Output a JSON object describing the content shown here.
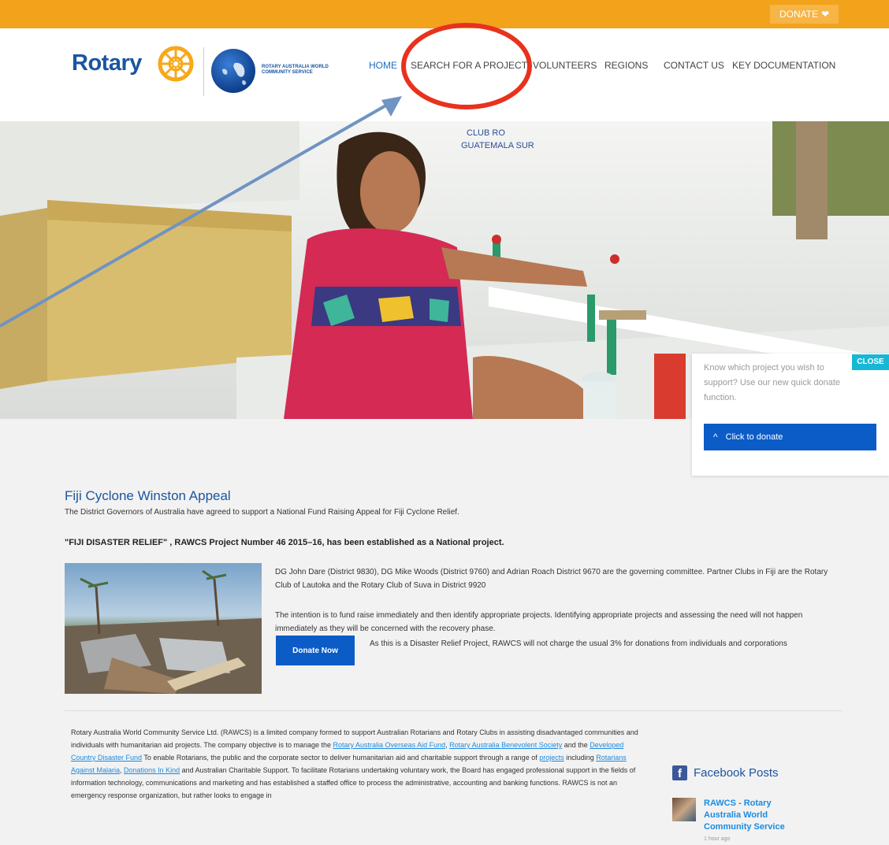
{
  "topbar": {
    "donate_label": "DONATE"
  },
  "brand": {
    "rotary": "Rotary",
    "rawcs_name": "ROTARY AUSTRALIA WORLD COMMUNITY SERVICE"
  },
  "nav": {
    "home": "HOME",
    "search": "SEARCH FOR A PROJECT",
    "volunteers": "VOLUNTEERS",
    "regions": "REGIONS",
    "contact": "CONTACT US",
    "docs": "KEY DOCUMENTATION"
  },
  "hero": {
    "sign_text_1": "CLUB RO",
    "sign_text_2": "GUATEMALA SUR"
  },
  "popup": {
    "close_label": "CLOSE",
    "text": "Know which project you wish to support? Use our new quick donate function.",
    "button_label": "Click to donate"
  },
  "appeal": {
    "title": "Fiji Cyclone Winston Appeal",
    "subtitle": "The District Governors of Australia have agreed to support a National Fund Raising Appeal for Fiji Cyclone Relief.",
    "bold_line": "\"FIJI DISASTER RELIEF\" , RAWCS Project Number 46 2015–16,  has been established as a National project.",
    "paragraph_1": "DG John Dare (District 9830), DG Mike Woods (District 9760) and Adrian Roach District 9670 are the governing committee. Partner Clubs in Fiji are the Rotary Club of Lautoka and the Rotary Club of Suva in District 9920",
    "paragraph_2": "The intention is to fund raise immediately and then identify appropriate projects. Identifying appropriate projects and assessing the need will not happen immediately as they will be concerned with the recovery phase.",
    "donate_now_label": "Donate Now",
    "paragraph_3": "As this is a Disaster Relief Project, RAWCS will not charge the usual 3% for donations from individuals and corporations"
  },
  "about": {
    "t1": "Rotary Australia World Community Service Ltd. (RAWCS) is a limited company formed to support Australian Rotarians and Rotary Clubs in assisting disadvantaged communities and individuals with humanitarian aid projects. The company objective is to manage the ",
    "l1": "Rotary Australia Overseas Aid Fund",
    "t2": ", ",
    "l2": "Rotary Australia Benevolent Society",
    "t3": " and the ",
    "l3": "Developed Country Disaster Fund",
    "t4": " To enable Rotarians, the public and the corporate sector to deliver humanitarian aid and charitable support through a range of ",
    "l4": "projects",
    "t5": " including ",
    "l5": "Rotarians Against Malaria",
    "t6": ", ",
    "l6": "Donations In Kind",
    "t7": " and Australian Charitable Support. To facilitate Rotarians undertaking voluntary work, the Board has engaged professional support in the fields of information technology, communications and marketing and has established a staffed office to process the administrative, accounting and banking functions. RAWCS is not an emergency response organization, but rather looks to engage in"
  },
  "facebook": {
    "title": "Facebook Posts",
    "post_name": "RAWCS - Rotary Australia World Community Service",
    "post_time": "1 hour ago"
  },
  "colors": {
    "accent_orange": "#f3a21c",
    "brand_blue": "#1b55a0",
    "button_blue": "#0b5cc6",
    "close_cyan": "#17b7d6",
    "annotation_red": "#e8321e",
    "annotation_arrow": "#6f93c2"
  }
}
